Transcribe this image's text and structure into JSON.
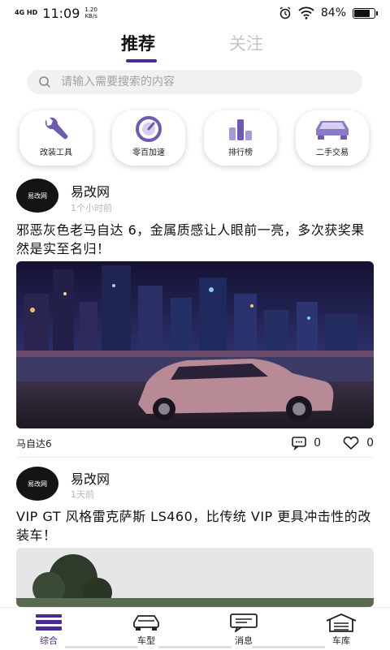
{
  "status_bar": {
    "network": "4G HD",
    "time": "11:09",
    "speed_value": "1.20",
    "speed_unit": "KB/s",
    "battery": "84%",
    "battery_level": 0.84
  },
  "tabs": [
    {
      "label": "推荐",
      "active": true
    },
    {
      "label": "关注",
      "active": false
    }
  ],
  "search": {
    "placeholder": "请输入需要搜索的内容"
  },
  "shortcuts": [
    {
      "label": "改装工具",
      "icon": "wrench-icon"
    },
    {
      "label": "零百加速",
      "icon": "speedometer-icon"
    },
    {
      "label": "排行榜",
      "icon": "ranking-icon"
    },
    {
      "label": "二手交易",
      "icon": "car-icon"
    }
  ],
  "posts": [
    {
      "author": "易改网",
      "avatar_text": "易改网",
      "time": "1个小时前",
      "title": "邪恶灰色老马自达 6，金属质感让人眼前一亮，多次获奖果然是实至名归！",
      "tag": "马自达6",
      "comments": "0",
      "likes": "0"
    },
    {
      "author": "易改网",
      "avatar_text": "易改网",
      "time": "1天前",
      "title": "VIP GT 风格雷克萨斯 LS460，比传统 VIP 更具冲击性的改装车！"
    }
  ],
  "bottom_nav": [
    {
      "label": "综合",
      "icon": "feed-icon",
      "active": true
    },
    {
      "label": "车型",
      "icon": "car-outline-icon",
      "active": false
    },
    {
      "label": "消息",
      "icon": "message-icon",
      "active": false
    },
    {
      "label": "车库",
      "icon": "garage-icon",
      "active": false
    }
  ],
  "colors": {
    "accent": "#4b2a93",
    "icon_purple": "#6e5ab0"
  }
}
